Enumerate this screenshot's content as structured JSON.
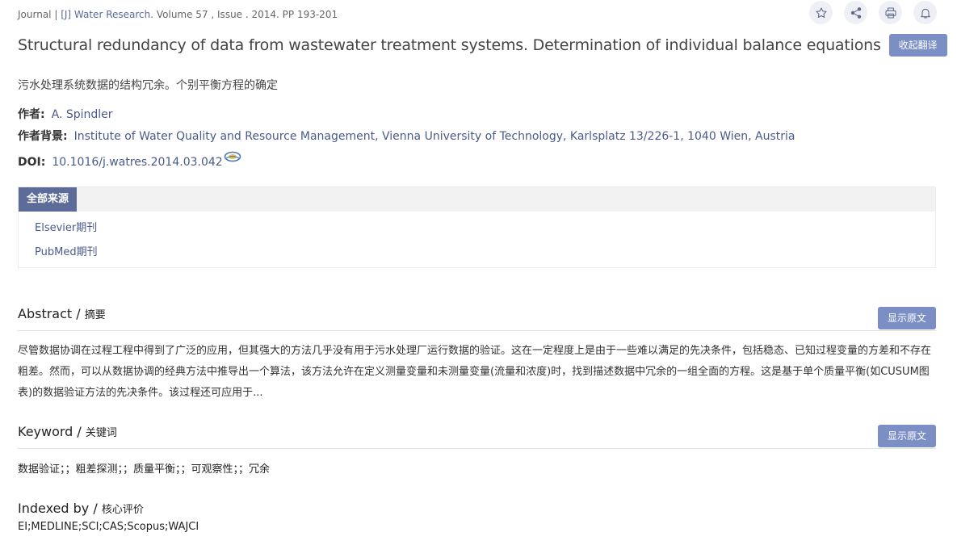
{
  "journal": {
    "prefix": "Journal | ",
    "name": "[J] Water Research",
    "details": ". Volume 57 , Issue . 2014. PP 193-201"
  },
  "toolbar": {
    "icons": [
      "star-icon",
      "share-icon",
      "print-icon",
      "bell-icon"
    ]
  },
  "title": {
    "en": "Structural redundancy of data from wastewater treatment systems. Determination of individual balance equations",
    "collapse_translation_label": "收起翻译",
    "cn": "污水处理系统数据的结构冗余。个别平衡方程的确定"
  },
  "meta": {
    "author_label": "作者:",
    "author": "A. Spindler",
    "affiliation_label": "作者背景:",
    "affiliation": "Institute of Water Quality and Resource Management, Vienna University of Technology, Karlsplatz 13/226-1, 1040 Wien, Austria",
    "doi_label": "DOI:",
    "doi": "10.1016/j.watres.2014.03.042"
  },
  "sources": {
    "tab_label": "全部来源",
    "items": [
      "Elsevier期刊",
      "PubMed期刊"
    ]
  },
  "abstract": {
    "heading_en": "Abstract / ",
    "heading_cn": "摘要",
    "show_original_label": "显示原文",
    "text": "尽管数据协调在过程工程中得到了广泛的应用，但其强大的方法几乎没有用于污水处理厂运行数据的验证。这在一定程度上是由于一些难以满足的先决条件，包括稳态、已知过程变量的方差和不存在粗差。然而，可以从数据协调的经典方法中推导出一个算法，该方法允许在定义测量变量和未测量变量(流量和浓度)时，找到描述数据中冗余的一组全面的方程。这是基于单个质量平衡(如CUSUM图表)的数据验证方法的先决条件。该过程还可应用于..."
  },
  "keyword": {
    "heading_en": "Keyword / ",
    "heading_cn": "关键词",
    "show_original_label": "显示原文",
    "text": "数据验证；；粗差探测；；质量平衡；；可观察性；；冗余"
  },
  "indexed": {
    "heading_en": "Indexed by / ",
    "heading_cn": "核心评价",
    "text": "EI;MEDLINE;SCI;CAS;Scopus;WAJCI"
  },
  "colors": {
    "accent": "#7b8fc4",
    "tab_active": "#5c6b98",
    "link": "#4a5a8c"
  }
}
